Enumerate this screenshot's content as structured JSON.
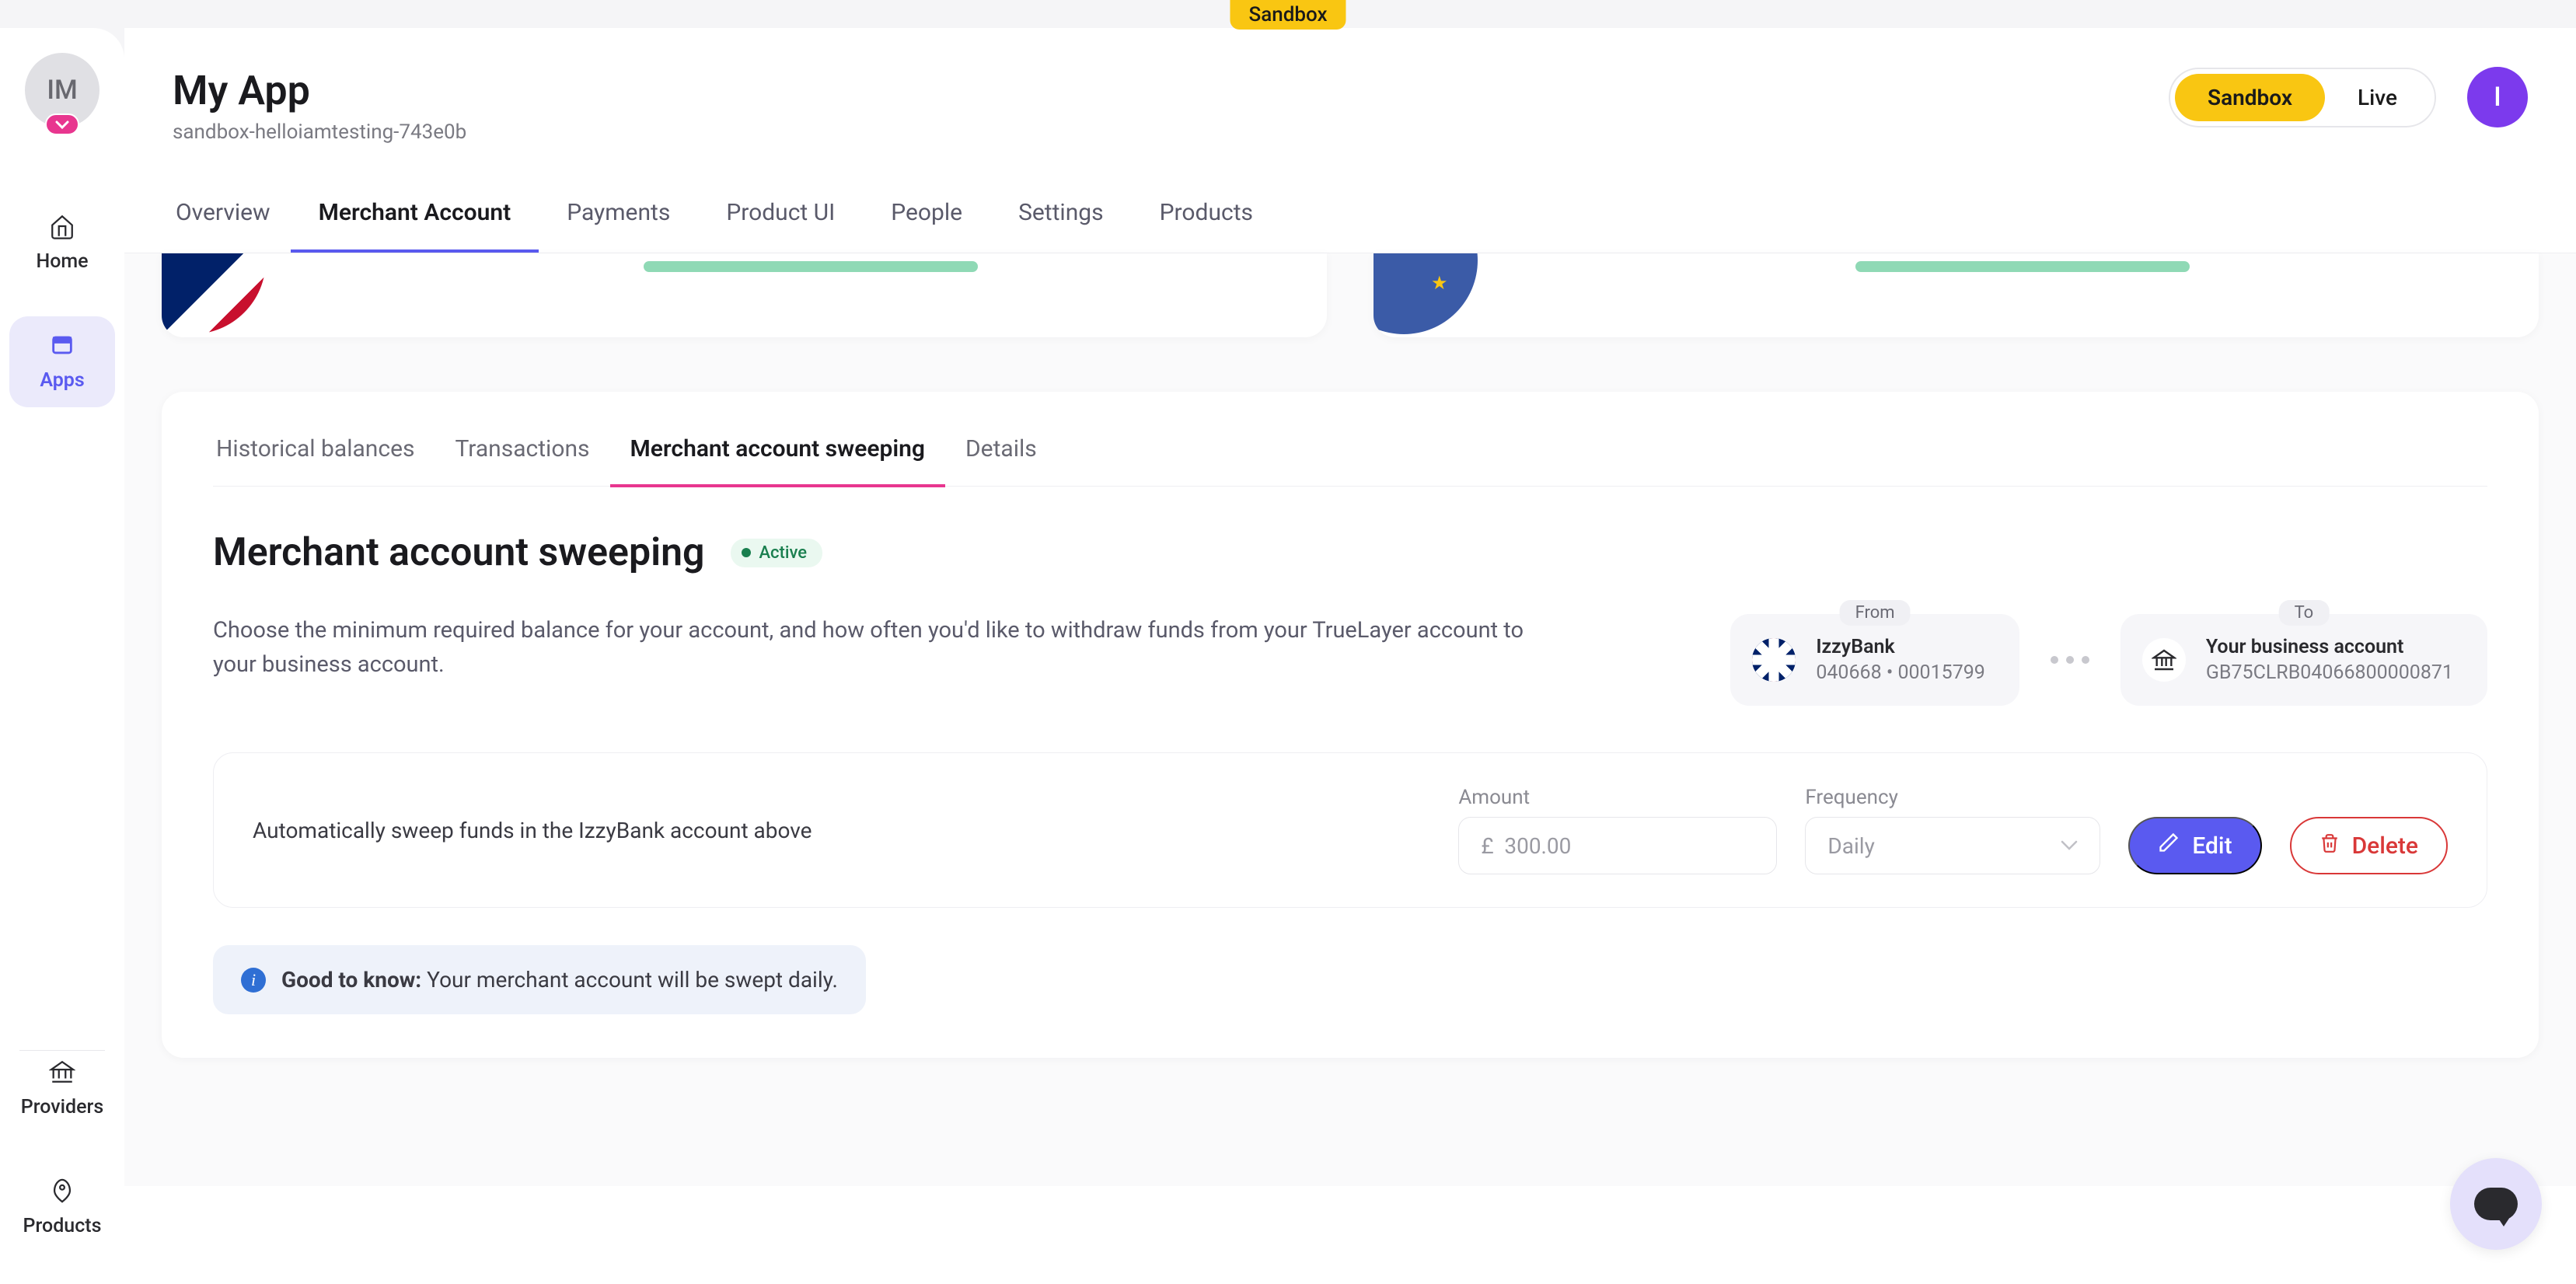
{
  "topPill": "Sandbox",
  "sidebar": {
    "avatarInitials": "IM",
    "items": {
      "home": "Home",
      "apps": "Apps",
      "providers": "Providers",
      "products": "Products"
    }
  },
  "header": {
    "appName": "My App",
    "clientId": "sandbox-helloiamtesting-743e0b",
    "envToggle": {
      "sandbox": "Sandbox",
      "live": "Live"
    },
    "userInitial": "I"
  },
  "mainTabs": {
    "overview": "Overview",
    "merchant": "Merchant Account",
    "payments": "Payments",
    "productUI": "Product UI",
    "people": "People",
    "settings": "Settings",
    "products": "Products"
  },
  "subTabs": {
    "historical": "Historical balances",
    "transactions": "Transactions",
    "sweeping": "Merchant account sweeping",
    "details": "Details"
  },
  "section": {
    "title": "Merchant account sweeping",
    "status": "Active",
    "description": "Choose the minimum required balance for your account, and how often you'd like to withdraw funds from your TrueLayer account to your business account."
  },
  "accounts": {
    "fromLabel": "From",
    "toLabel": "To",
    "from": {
      "name": "IzzyBank",
      "detail": "040668 • 00015799"
    },
    "to": {
      "name": "Your business account",
      "detail": "GB75CLRB04066800000871"
    }
  },
  "config": {
    "text": "Automatically sweep funds in the IzzyBank account above",
    "amountLabel": "Amount",
    "currency": "£",
    "amountValue": "300.00",
    "frequencyLabel": "Frequency",
    "frequencyValue": "Daily",
    "editLabel": "Edit",
    "deleteLabel": "Delete"
  },
  "info": {
    "prefix": "Good to know:",
    "text": " Your merchant account will be swept daily."
  }
}
